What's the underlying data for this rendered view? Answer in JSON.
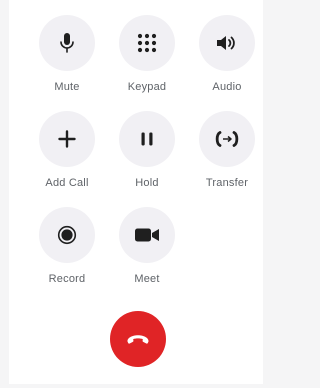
{
  "controls": [
    {
      "label": "Mute",
      "icon": "microphone-icon"
    },
    {
      "label": "Keypad",
      "icon": "dialpad-icon"
    },
    {
      "label": "Audio",
      "icon": "speaker-icon"
    },
    {
      "label": "Add Call",
      "icon": "plus-icon"
    },
    {
      "label": "Hold",
      "icon": "pause-icon"
    },
    {
      "label": "Transfer",
      "icon": "transfer-icon"
    },
    {
      "label": "Record",
      "icon": "record-icon"
    },
    {
      "label": "Meet",
      "icon": "video-camera-icon"
    }
  ],
  "end_call": {
    "icon": "hang-up-icon"
  },
  "colors": {
    "button_bg": "#f1f0f4",
    "icon": "#1f1f1f",
    "label": "#5f6368",
    "end_call": "#e02426"
  }
}
